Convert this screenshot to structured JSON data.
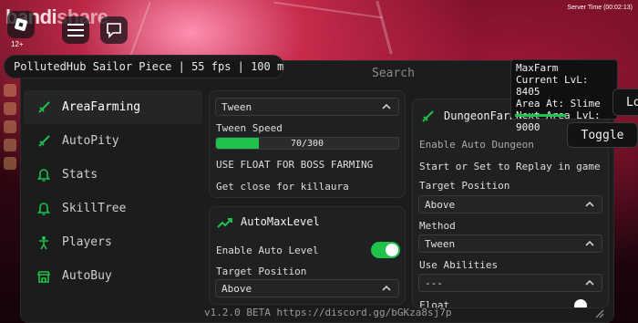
{
  "watermark": {
    "main": "bandi",
    "accent": "share"
  },
  "age_rating": "12+",
  "server_time": "Server Time (00:02:13)",
  "title_bar": "PollutedHub Sailor Piece | 55 fps | 100 ms",
  "search_placeholder": "Search",
  "sidebar": {
    "items": [
      {
        "label": "AreaFarming",
        "icon": "sword-icon",
        "active": true
      },
      {
        "label": "AutoPity",
        "icon": "sword-icon",
        "active": false
      },
      {
        "label": "Stats",
        "icon": "bell-icon",
        "active": false
      },
      {
        "label": "SkillTree",
        "icon": "bell-icon",
        "active": false
      },
      {
        "label": "Players",
        "icon": "person-icon",
        "active": false
      },
      {
        "label": "AutoBuy",
        "icon": "shop-icon",
        "active": false
      }
    ]
  },
  "farming_panel": {
    "mode_value": "Tween",
    "tween_speed_label": "Tween Speed",
    "tween_speed_value": "70/300",
    "tween_speed_fraction": 0.233,
    "float_label": "USE FLOAT FOR BOSS FARMING",
    "close_label": "Get close for killaura"
  },
  "automaxlevel_panel": {
    "title": "AutoMaxLevel",
    "enable_label": "Enable Auto Level",
    "enable_on": true,
    "target_position_label": "Target Position",
    "target_position_value": "Above"
  },
  "dungeon_panel": {
    "title": "DungeonFarm",
    "enable_label": "Enable Auto Dungeon",
    "replay_label": "Start or Set to Replay in game",
    "target_position_label": "Target Position",
    "target_position_value": "Above",
    "method_label": "Method",
    "method_value": "Tween",
    "abilities_label": "Use Abilities",
    "abilities_value": "---",
    "float_label": "Float"
  },
  "maxfarm": {
    "title": "MaxFarm",
    "current": "Current LvL: 8405",
    "area": "Area At: Slime",
    "next": "Next Area LvL:",
    "next_value": "9000"
  },
  "toggle_button": "Toggle",
  "lo_button": "Lo",
  "footer": "v1.2.0 BETA https://discord.gg/bGKza8sj7p",
  "colors": {
    "accent": "#1fc24a",
    "panel": "#1f2021",
    "window": "#1b1c1d"
  }
}
